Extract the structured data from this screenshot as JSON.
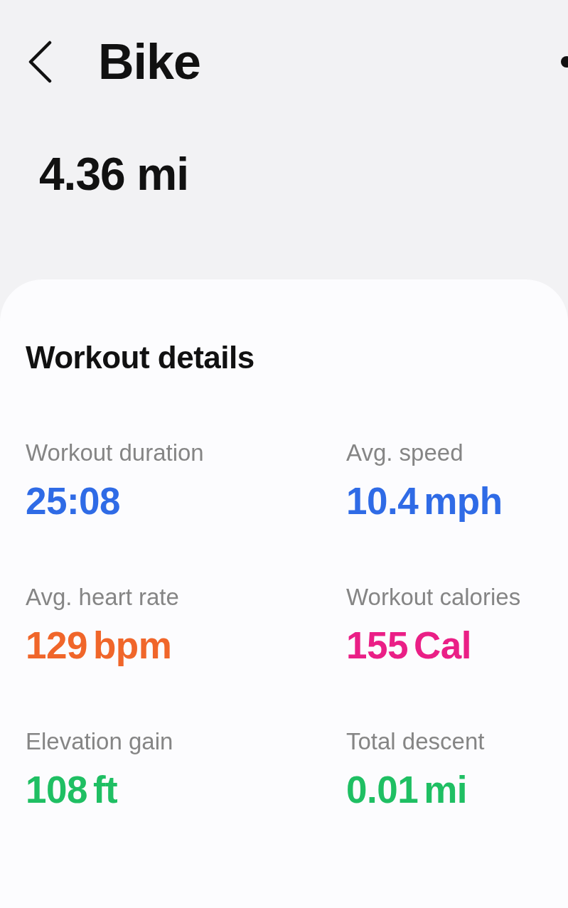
{
  "header": {
    "title": "Bike"
  },
  "distance": "4.36 mi",
  "details": {
    "title": "Workout details",
    "metrics": [
      {
        "label": "Workout duration",
        "value": "25:08",
        "color": "#2f6be6"
      },
      {
        "label": "Avg. speed",
        "value": "10.4",
        "unit": "mph",
        "color": "#2f6be6"
      },
      {
        "label": "Avg. heart rate",
        "value": "129",
        "unit": "bpm",
        "color": "#f0662a"
      },
      {
        "label": "Workout calories",
        "value": "155",
        "unit": "Cal",
        "color": "#ea1f86"
      },
      {
        "label": "Elevation gain",
        "value": "108",
        "unit": "ft",
        "color": "#1fbf63"
      },
      {
        "label": "Total descent",
        "value": "0.01",
        "unit": "mi",
        "color": "#1fbf63"
      }
    ]
  }
}
